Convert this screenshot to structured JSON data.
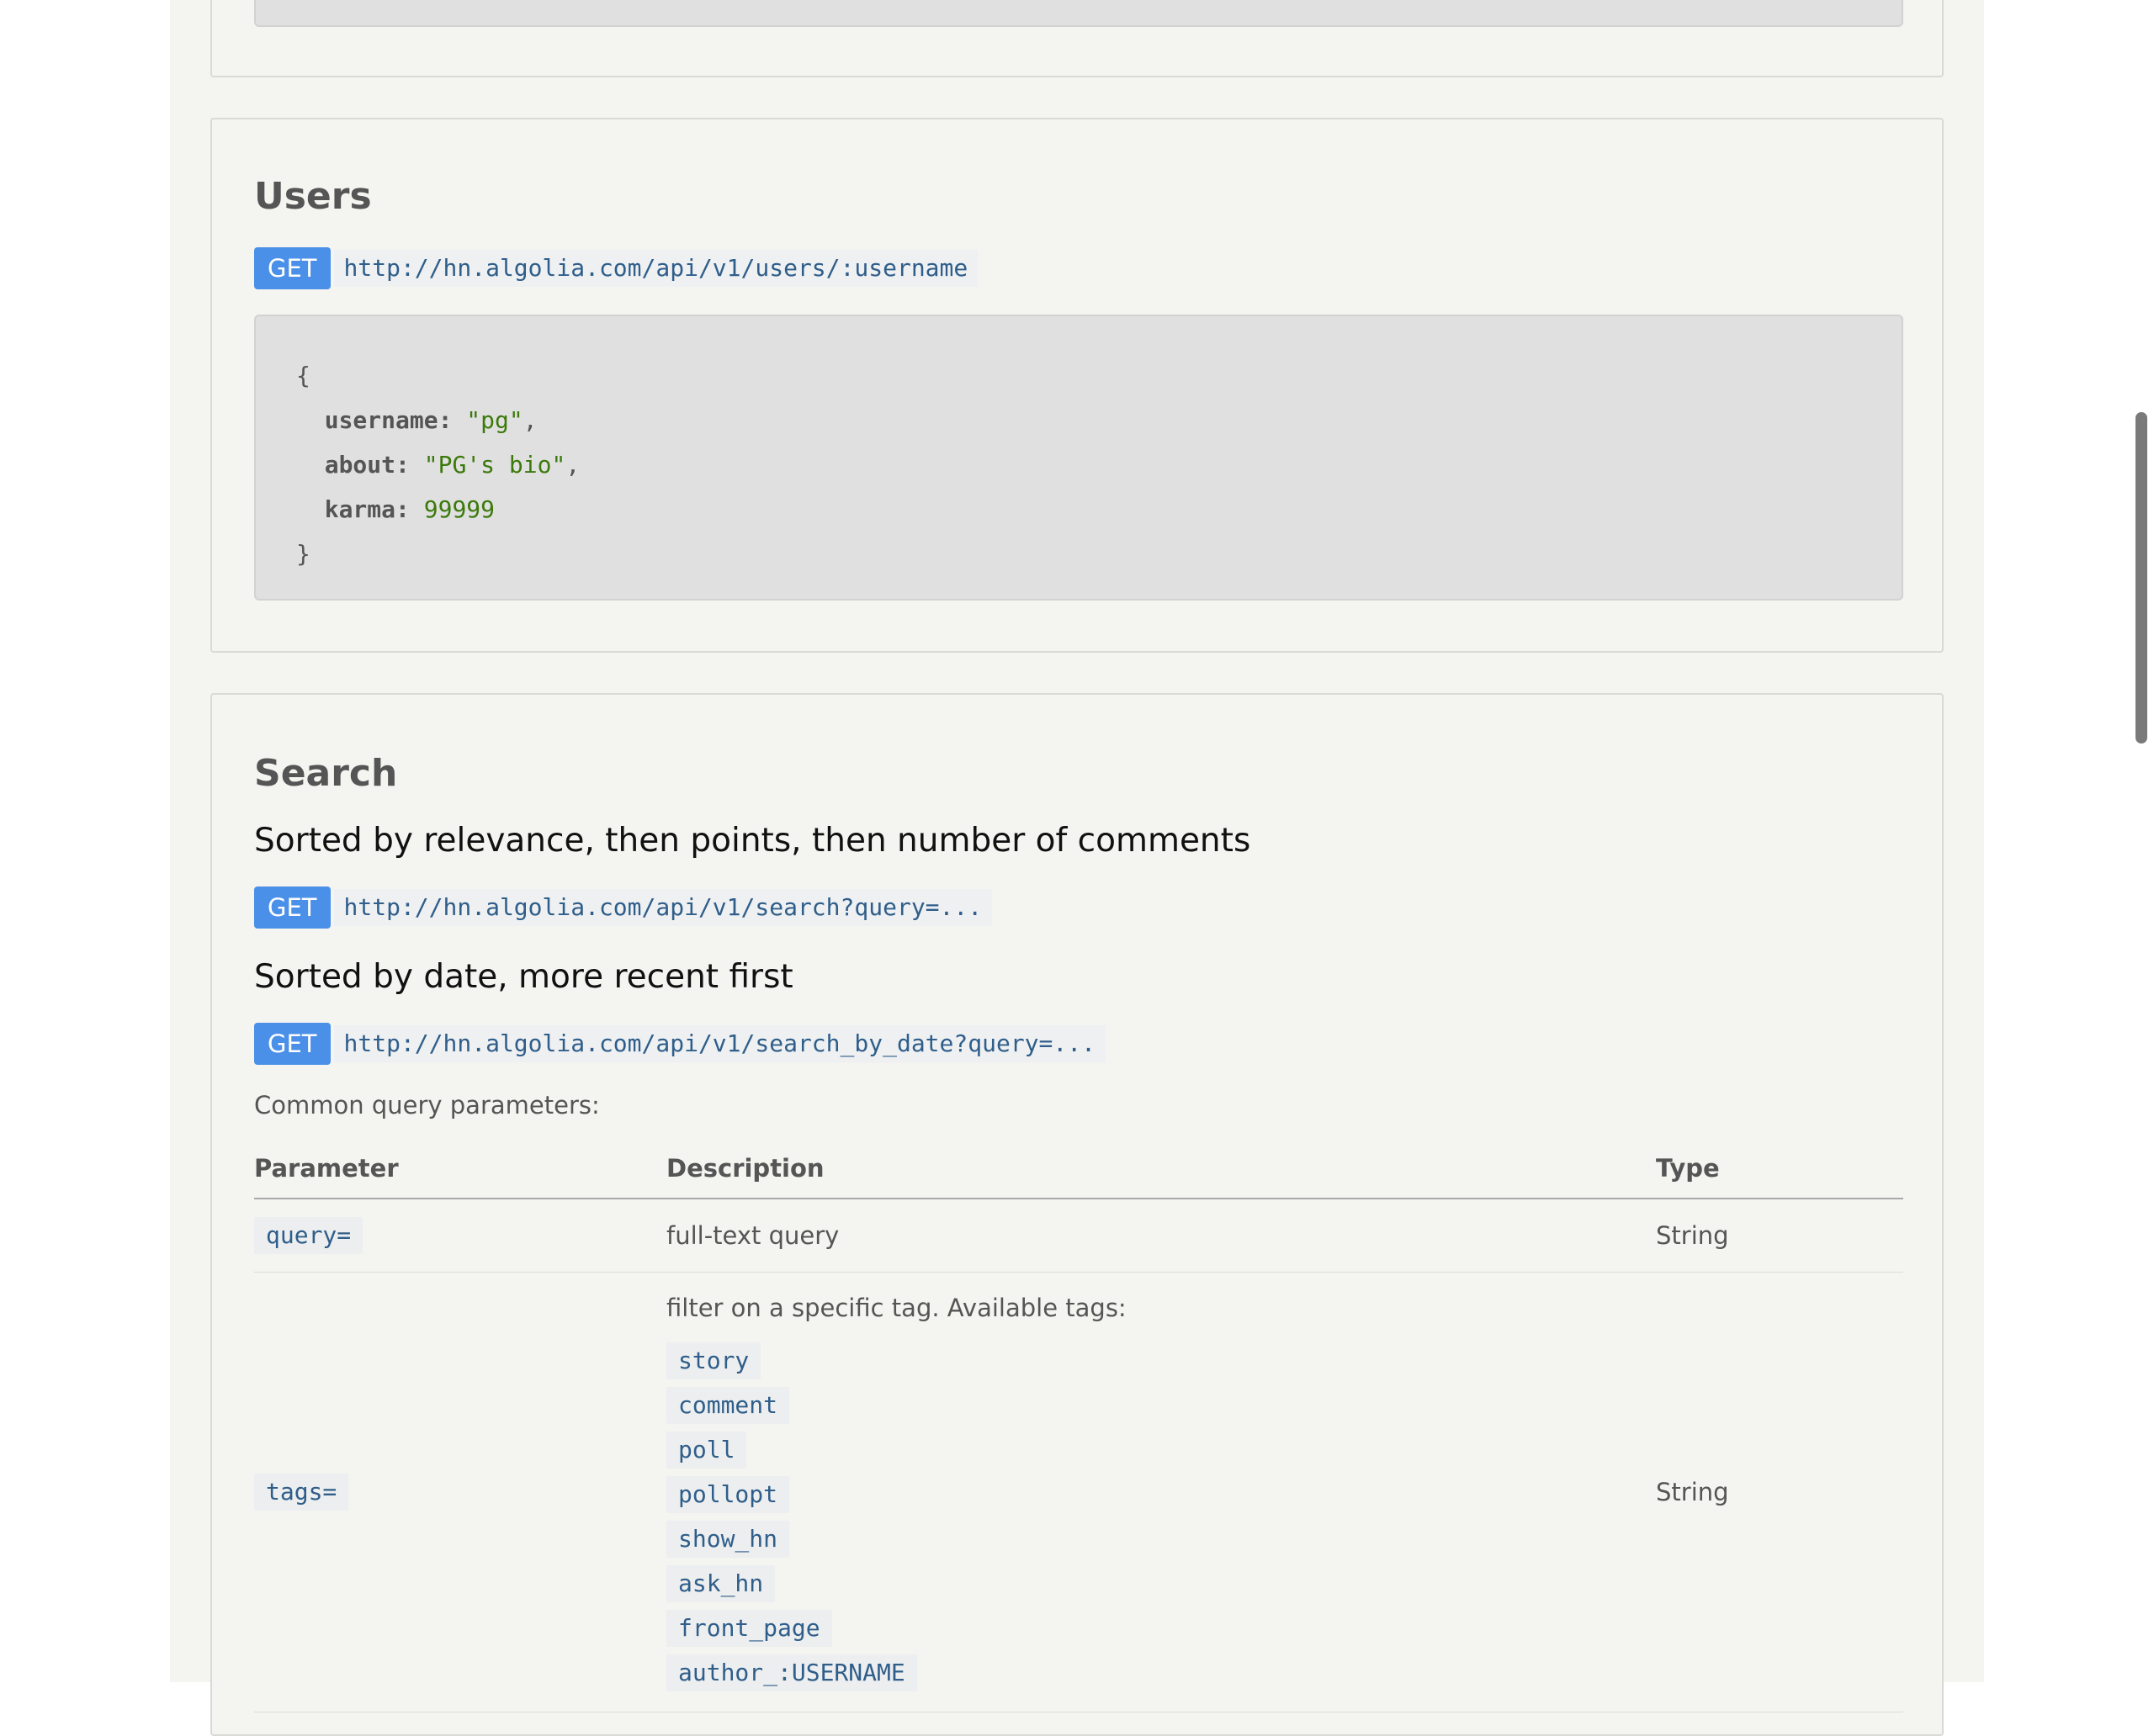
{
  "users": {
    "title": "Users",
    "method": "GET",
    "url": "http://hn.algolia.com/api/v1/users/:username",
    "response": {
      "open": "{",
      "close": "}",
      "fields": [
        {
          "key": "username:",
          "value": "\"pg\"",
          "suffix": ","
        },
        {
          "key": "about:",
          "value": "\"PG's bio\"",
          "suffix": ","
        },
        {
          "key": "karma:",
          "value": "99999",
          "suffix": ""
        }
      ]
    }
  },
  "search": {
    "title": "Search",
    "relevance": {
      "heading": "Sorted by relevance, then points, then number of comments",
      "method": "GET",
      "url": "http://hn.algolia.com/api/v1/search?query=..."
    },
    "by_date": {
      "heading": "Sorted by date, more recent first",
      "method": "GET",
      "url": "http://hn.algolia.com/api/v1/search_by_date?query=..."
    },
    "params_intro": "Common query parameters:",
    "table": {
      "headers": {
        "parameter": "Parameter",
        "description": "Description",
        "type": "Type"
      },
      "rows": [
        {
          "parameter": "query=",
          "description": "full-text query",
          "type": "String"
        },
        {
          "parameter": "tags=",
          "description": "filter on a specific tag. Available tags:",
          "type": "String",
          "tags": [
            "story",
            "comment",
            "poll",
            "pollopt",
            "show_hn",
            "ask_hn",
            "front_page",
            "author_:USERNAME"
          ]
        }
      ]
    }
  }
}
